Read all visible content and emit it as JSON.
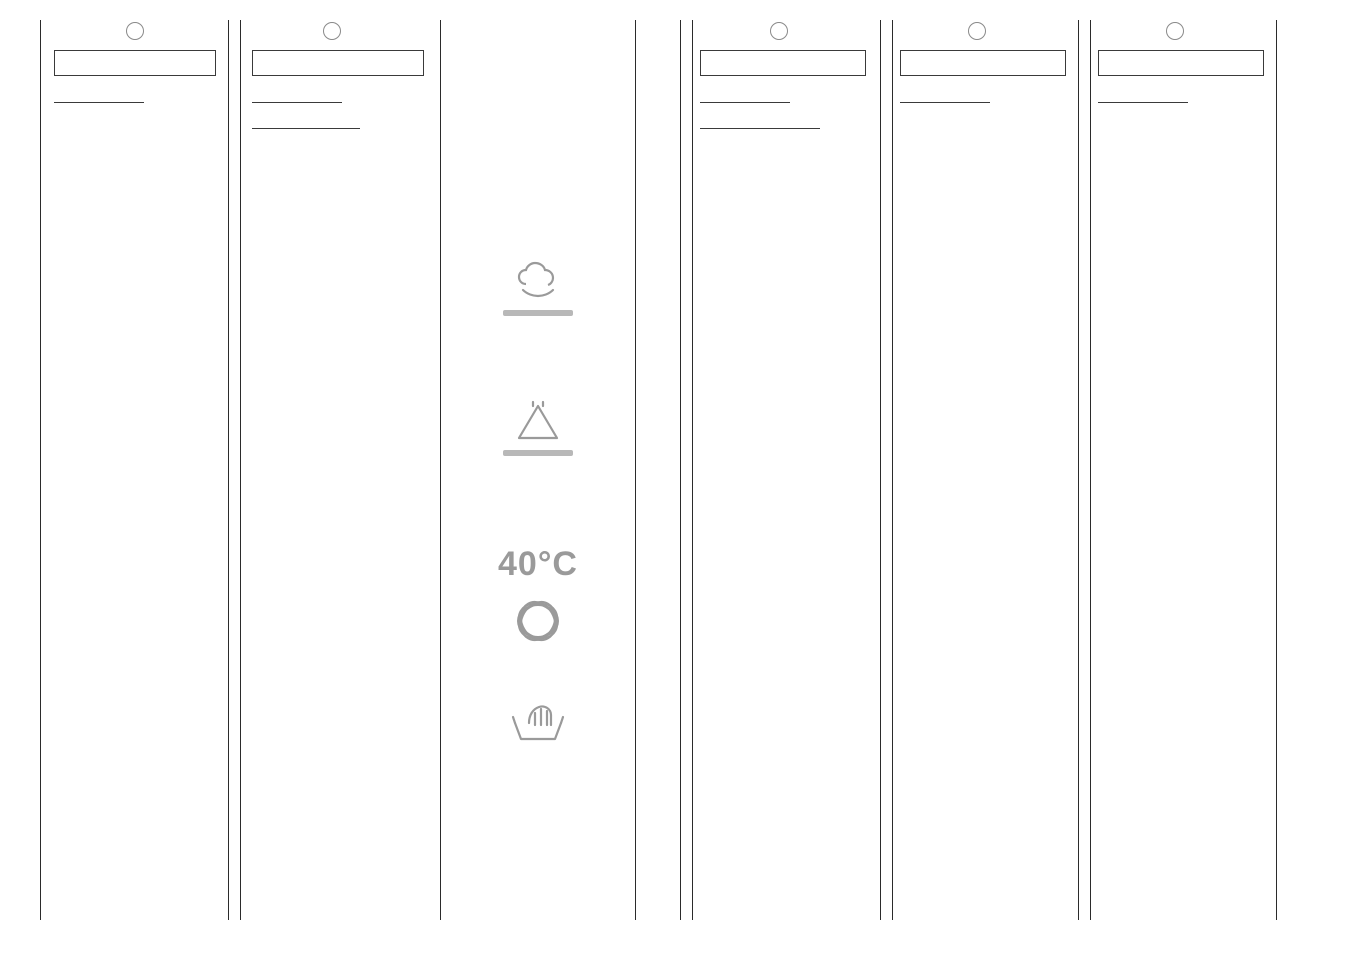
{
  "columns": [
    {
      "id": "col-1",
      "has_circle": true,
      "underlines": 1
    },
    {
      "id": "col-2",
      "has_circle": true,
      "underlines": 2
    },
    {
      "id": "col-3-narrow",
      "has_circle": false,
      "underlines": 0,
      "feature_column": true
    },
    {
      "id": "col-4-thin",
      "has_circle": false,
      "underlines": 0
    },
    {
      "id": "col-5",
      "has_circle": true,
      "underlines": 2
    },
    {
      "id": "col-6",
      "has_circle": true,
      "underlines": 1
    },
    {
      "id": "col-7",
      "has_circle": true,
      "underlines": 1
    }
  ],
  "features": {
    "cotton_icon": "cotton-icon",
    "bleach_icon": "bleach-triangle-icon",
    "temperature_text": "40°C",
    "woolmark_icon": "woolmark-icon",
    "handwash_icon": "hand-wash-icon"
  }
}
